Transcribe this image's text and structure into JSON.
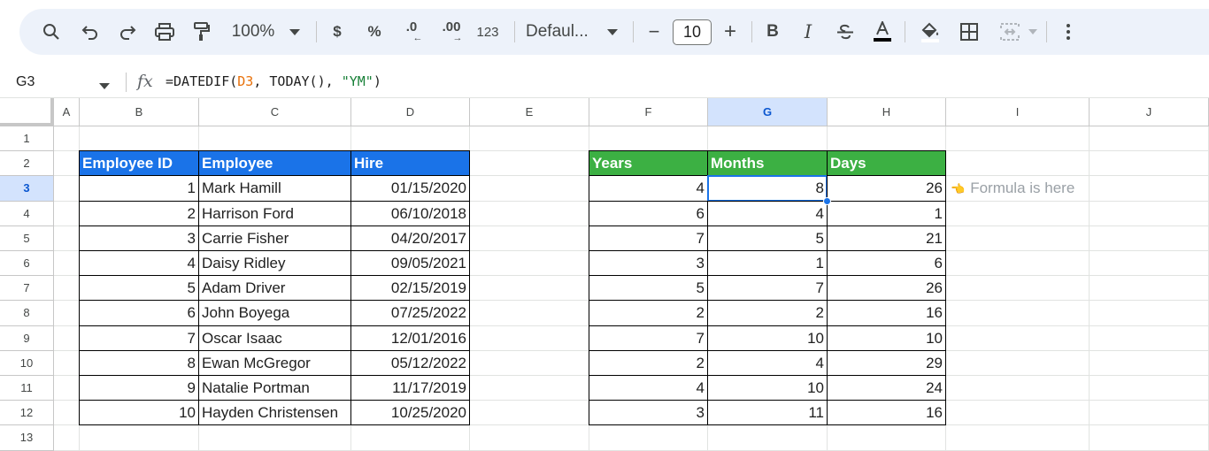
{
  "toolbar": {
    "zoom": "100%",
    "currency": "$",
    "percent": "%",
    "decrease_decimal": ".0",
    "increase_decimal": ".00",
    "number_format": "123",
    "font": "Defaul...",
    "font_size": "10",
    "decrease_size": "−",
    "increase_size": "+",
    "bold": "B",
    "italic": "I"
  },
  "formula_bar": {
    "name_box": "G3",
    "fx": "fx",
    "f_prefix": "=DATEDIF(",
    "f_ref": "D3",
    "f_mid": ", TODAY(), ",
    "f_str": "\"YM\"",
    "f_suffix": ")"
  },
  "columns": [
    "A",
    "B",
    "C",
    "D",
    "E",
    "F",
    "G",
    "H",
    "I",
    "J"
  ],
  "rows": [
    "1",
    "2",
    "3",
    "4",
    "5",
    "6",
    "7",
    "8",
    "9",
    "10",
    "11",
    "12",
    "13"
  ],
  "left_table": {
    "headers": [
      "Employee ID",
      "Employee",
      "Hire"
    ],
    "rows": [
      [
        "1",
        "Mark Hamill",
        "01/15/2020"
      ],
      [
        "2",
        "Harrison Ford",
        "06/10/2018"
      ],
      [
        "3",
        "Carrie Fisher",
        "04/20/2017"
      ],
      [
        "4",
        "Daisy Ridley",
        "09/05/2021"
      ],
      [
        "5",
        "Adam Driver",
        "02/15/2019"
      ],
      [
        "6",
        "John Boyega",
        "07/25/2022"
      ],
      [
        "7",
        "Oscar Isaac",
        "12/01/2016"
      ],
      [
        "8",
        "Ewan McGregor",
        "05/12/2022"
      ],
      [
        "9",
        "Natalie Portman",
        "11/17/2019"
      ],
      [
        "10",
        "Hayden Christensen",
        "10/25/2020"
      ]
    ]
  },
  "right_table": {
    "headers": [
      "Years",
      "Months",
      "Days"
    ],
    "rows": [
      [
        "4",
        "8",
        "26"
      ],
      [
        "6",
        "4",
        "1"
      ],
      [
        "7",
        "5",
        "21"
      ],
      [
        "3",
        "1",
        "6"
      ],
      [
        "5",
        "7",
        "26"
      ],
      [
        "2",
        "2",
        "16"
      ],
      [
        "7",
        "10",
        "10"
      ],
      [
        "2",
        "4",
        "29"
      ],
      [
        "4",
        "10",
        "24"
      ],
      [
        "3",
        "11",
        "16"
      ]
    ]
  },
  "note": {
    "icon": "👈",
    "text": "Formula is here"
  },
  "selected_cell": "G3",
  "colors": {
    "header_blue": "#1a73e8",
    "header_green": "#3cb043",
    "selection": "#1a73e8"
  }
}
